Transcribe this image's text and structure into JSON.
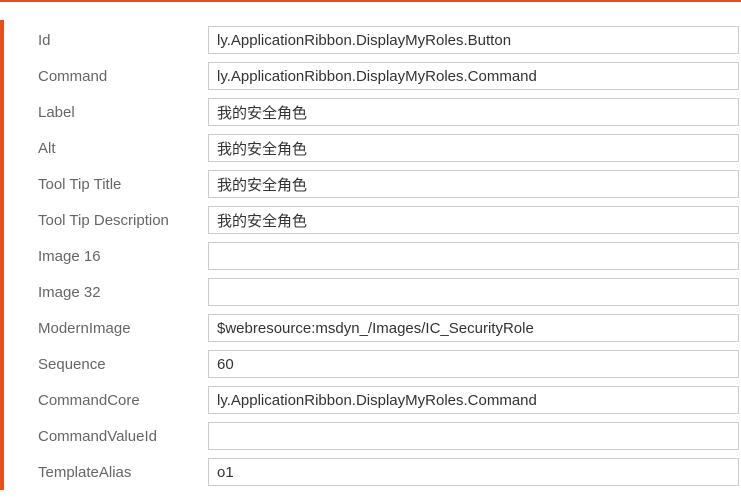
{
  "fields": {
    "id": {
      "label": "Id",
      "value": "ly.ApplicationRibbon.DisplayMyRoles.Button"
    },
    "command": {
      "label": "Command",
      "value": "ly.ApplicationRibbon.DisplayMyRoles.Command"
    },
    "label": {
      "label": "Label",
      "value": "我的安全角色"
    },
    "alt": {
      "label": "Alt",
      "value": "我的安全角色"
    },
    "tooltipTitle": {
      "label": "Tool Tip Title",
      "value": "我的安全角色"
    },
    "tooltipDescription": {
      "label": "Tool Tip Description",
      "value": "我的安全角色"
    },
    "image16": {
      "label": "Image 16",
      "value": ""
    },
    "image32": {
      "label": "Image 32",
      "value": ""
    },
    "modernImage": {
      "label": "ModernImage",
      "value": "$webresource:msdyn_/Images/IC_SecurityRole"
    },
    "sequence": {
      "label": "Sequence",
      "value": "60"
    },
    "commandCore": {
      "label": "CommandCore",
      "value": "ly.ApplicationRibbon.DisplayMyRoles.Command"
    },
    "commandValueId": {
      "label": "CommandValueId",
      "value": ""
    },
    "templateAlias": {
      "label": "TemplateAlias",
      "value": "o1"
    }
  },
  "colors": {
    "accent": "#e94f1d"
  }
}
